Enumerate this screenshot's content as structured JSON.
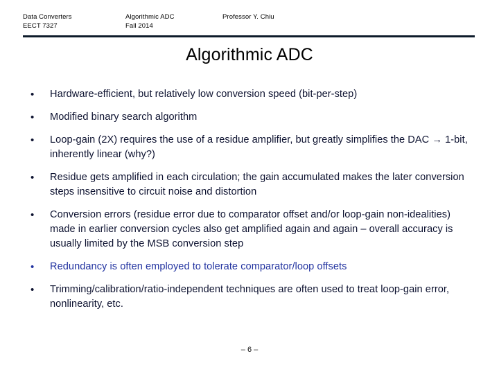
{
  "slide": {
    "header": {
      "course_name": "Data Converters",
      "course_code": "EECT 7327",
      "topic": "Algorithmic ADC",
      "term": "Fall 2014",
      "instructor": "Professor Y. Chiu"
    },
    "title": "Algorithmic ADC",
    "bullet_marker": "•",
    "bullets": [
      {
        "text": "Hardware-efficient, but relatively low conversion speed (bit-per-step)",
        "accent": false
      },
      {
        "text": "Modified binary search algorithm",
        "accent": false
      },
      {
        "text": "Loop-gain (2X) requires the use of a residue amplifier, but greatly simplifies the DAC → 1-bit, inherently linear (why?)",
        "accent": false
      },
      {
        "text": "Residue gets amplified in each circulation; the gain accumulated makes the later conversion steps insensitive to circuit noise and distortion",
        "accent": false
      },
      {
        "text": "Conversion errors (residue error due to comparator offset and/or loop-gain non-idealities) made in earlier conversion cycles also get amplified again and again – overall accuracy is usually limited by the MSB conversion step",
        "accent": false
      },
      {
        "text": "Redundancy is often employed to tolerate comparator/loop offsets",
        "accent": true
      },
      {
        "text": "Trimming/calibration/ratio-independent techniques are often used to treat loop-gain error, nonlinearity, etc.",
        "accent": false
      }
    ],
    "footer": {
      "page_label": "– 6 –"
    },
    "colors": {
      "rule": "#0d1b2a",
      "body_text": "#0d1230",
      "accent_text": "#2233a0",
      "title_text": "#000000",
      "background": "#ffffff"
    }
  }
}
